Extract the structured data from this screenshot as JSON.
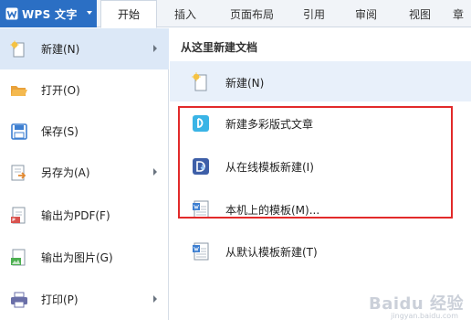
{
  "app": {
    "title": "WPS 文字"
  },
  "tabs": [
    {
      "label": "开始",
      "active": true
    },
    {
      "label": "插入",
      "active": false
    },
    {
      "label": "页面布局",
      "active": false
    },
    {
      "label": "引用",
      "active": false
    },
    {
      "label": "审阅",
      "active": false
    },
    {
      "label": "视图",
      "active": false
    },
    {
      "label": "章",
      "active": false
    }
  ],
  "left_menu": {
    "items": [
      {
        "label": "新建(N)",
        "icon": "new-document-icon",
        "has_submenu": true,
        "active": true
      },
      {
        "label": "打开(O)",
        "icon": "open-folder-icon",
        "has_submenu": false,
        "active": false
      },
      {
        "label": "保存(S)",
        "icon": "save-disk-icon",
        "has_submenu": false,
        "active": false
      },
      {
        "label": "另存为(A)",
        "icon": "save-as-icon",
        "has_submenu": true,
        "active": false
      },
      {
        "label": "输出为PDF(F)",
        "icon": "export-pdf-icon",
        "has_submenu": false,
        "active": false
      },
      {
        "label": "输出为图片(G)",
        "icon": "export-image-icon",
        "has_submenu": false,
        "active": false
      },
      {
        "label": "打印(P)",
        "icon": "printer-icon",
        "has_submenu": true,
        "active": false
      }
    ]
  },
  "right_panel": {
    "heading": "从这里新建文档",
    "items": [
      {
        "label": "新建(N)",
        "icon": "new-blank-icon"
      },
      {
        "label": "新建多彩版式文章",
        "icon": "colorful-article-icon"
      },
      {
        "label": "从在线模板新建(I)",
        "icon": "online-template-icon"
      },
      {
        "label": "本机上的模板(M)...",
        "icon": "local-template-icon"
      },
      {
        "label": "从默认模板新建(T)",
        "icon": "default-template-icon"
      }
    ]
  },
  "watermark": {
    "text": "Baidu 经验",
    "sub": "jingyan.baidu.com"
  },
  "colors": {
    "accent": "#2b6fc4",
    "highlight_frame": "#e22a2a",
    "active_bg": "#dce8f7"
  }
}
